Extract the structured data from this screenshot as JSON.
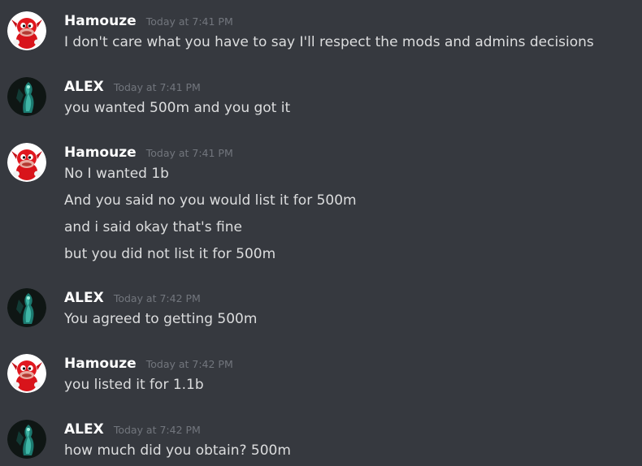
{
  "users": {
    "hamouze": {
      "name": "Hamouze",
      "avatar_icon": "red-knuckles-avatar-icon"
    },
    "alex": {
      "name": "ALEX",
      "avatar_icon": "teal-figure-avatar-icon"
    }
  },
  "messages": [
    {
      "author": "Hamouze",
      "timestamp": "Today at 7:41 PM",
      "lines": [
        "I don't care what you have to say I'll respect the mods and admins decisions"
      ]
    },
    {
      "author": "ALEX",
      "timestamp": "Today at 7:41 PM",
      "lines": [
        "you wanted 500m and you got it"
      ]
    },
    {
      "author": "Hamouze",
      "timestamp": "Today at 7:41 PM",
      "lines": [
        "No I wanted 1b",
        "And you said no you would list it for 500m",
        "and i said okay that's fine",
        "but you did not list it for 500m"
      ]
    },
    {
      "author": "ALEX",
      "timestamp": "Today at 7:42 PM",
      "lines": [
        "You agreed to getting 500m"
      ]
    },
    {
      "author": "Hamouze",
      "timestamp": "Today at 7:42 PM",
      "lines": [
        "you listed it for 1.1b"
      ]
    },
    {
      "author": "ALEX",
      "timestamp": "Today at 7:42 PM",
      "lines": [
        "how much did you obtain? 500m"
      ]
    }
  ],
  "colors": {
    "background": "#36393f",
    "username": "#ffffff",
    "timestamp": "#72767d",
    "text": "#dcddde"
  }
}
